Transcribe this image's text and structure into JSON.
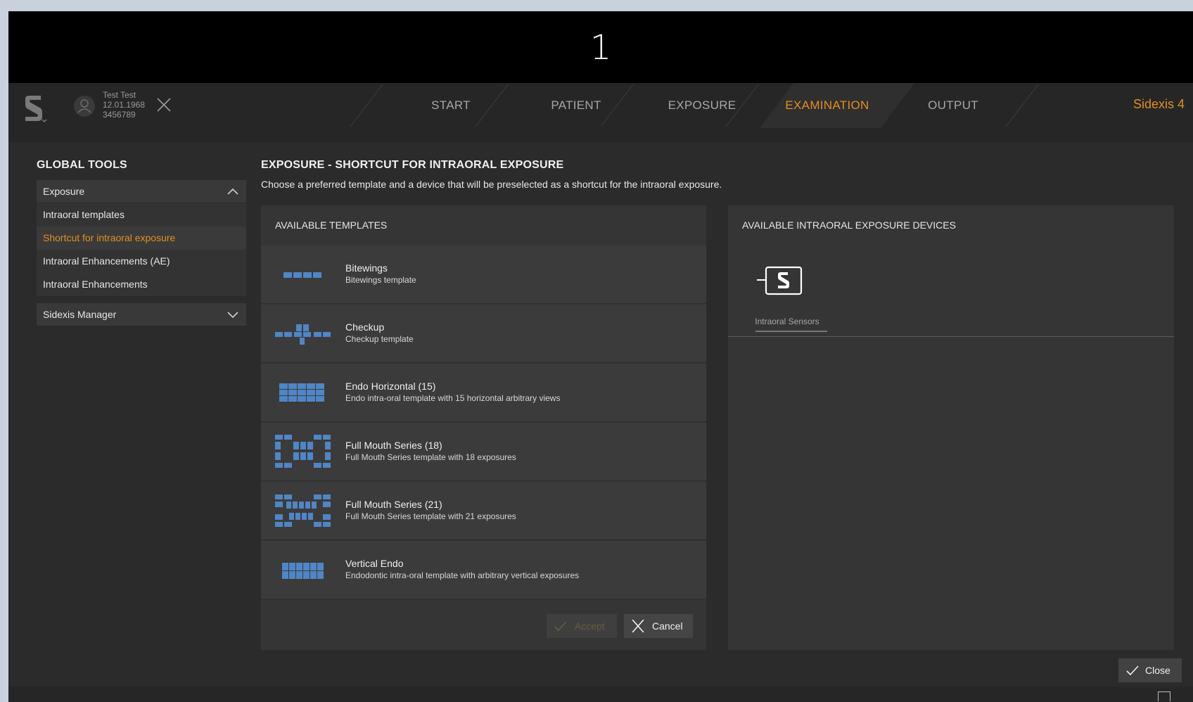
{
  "step": {
    "number": "1"
  },
  "header": {
    "patient": {
      "line1": "Test  Test",
      "line2": "12.01.1968",
      "line3": "3456789"
    },
    "tabs": [
      {
        "label": "START",
        "active": false
      },
      {
        "label": "PATIENT",
        "active": false
      },
      {
        "label": "EXPOSURE",
        "active": false
      },
      {
        "label": "EXAMINATION",
        "active": true
      },
      {
        "label": "OUTPUT",
        "active": false
      }
    ],
    "brand": "Sidexis 4",
    "accent_color": "#e3901e"
  },
  "sidebar": {
    "title": "GLOBAL TOOLS",
    "groups": [
      {
        "label": "Exposure",
        "expanded": true,
        "items": [
          {
            "label": "Intraoral templates",
            "selected": false
          },
          {
            "label": "Shortcut for intraoral exposure",
            "selected": true
          },
          {
            "label": "Intraoral Enhancements (AE)",
            "selected": false
          },
          {
            "label": "Intraoral Enhancements",
            "selected": false
          }
        ]
      },
      {
        "label": "Sidexis Manager",
        "expanded": false
      }
    ]
  },
  "main": {
    "title": "EXPOSURE  -  SHORTCUT FOR INTRAORAL EXPOSURE",
    "description": "Choose a preferred template and a device that will be preselected as a shortcut for the intraoral exposure.",
    "templates_panel": {
      "title": "AVAILABLE TEMPLATES",
      "templates": [
        {
          "name": "Bitewings",
          "description": "Bitewings template",
          "icon": "bitewings-icon"
        },
        {
          "name": "Checkup",
          "description": "Checkup template",
          "icon": "checkup-icon"
        },
        {
          "name": "Endo Horizontal (15)",
          "description": "Endo intra-oral template with 15 horizontal arbitrary views",
          "icon": "endo-horizontal-icon"
        },
        {
          "name": "Full Mouth Series (18)",
          "description": "Full Mouth Series template with 18 exposures",
          "icon": "full-mouth-18-icon"
        },
        {
          "name": "Full Mouth Series (21)",
          "description": "Full Mouth Series template with 21 exposures",
          "icon": "full-mouth-21-icon"
        },
        {
          "name": "Vertical Endo",
          "description": "Endodontic intra-oral template with arbitrary vertical exposures",
          "icon": "vertical-endo-icon"
        }
      ],
      "accept_label": "Accept",
      "cancel_label": "Cancel"
    },
    "devices_panel": {
      "title": "AVAILABLE INTRAORAL EXPOSURE DEVICES",
      "devices": [
        {
          "label": "Intraoral Sensors",
          "icon": "intraoral-sensor-icon"
        }
      ]
    },
    "close_label": "Close"
  }
}
